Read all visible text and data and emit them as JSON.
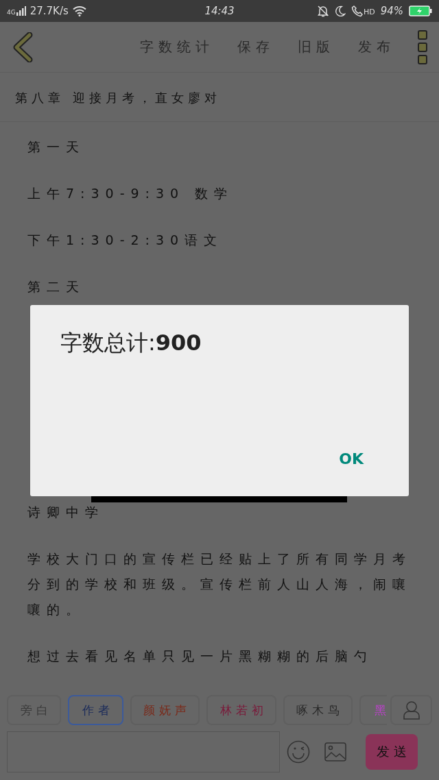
{
  "status_bar": {
    "network": "4G",
    "speed": "27.7K/s",
    "time": "14:43",
    "hd": "HD",
    "battery": "94%"
  },
  "app_bar": {
    "actions": [
      "字数统计",
      "保存",
      "旧版",
      "发布"
    ]
  },
  "document": {
    "title": "第八章 迎接月考，直女廖对",
    "paragraphs_above_dialog": [
      "第一天",
      "上午7:30-9:30 数学",
      "下午1:30-2:30语文",
      "第二天"
    ],
    "paragraphs_below_dialog": [
      "诗卿中学",
      "学校大门口的宣传栏已经贴上了所有同学月考分到的学校和班级。宣传栏前人山人海，闹嚷嚷的。",
      "想过去看见名单只见一片黑糊糊的后脑勺"
    ]
  },
  "dialog": {
    "message": "字数总计:**900**",
    "button": "OK"
  },
  "roles": [
    {
      "label": "旁白",
      "selected": false,
      "color": "#3a3a3a"
    },
    {
      "label": "作者",
      "selected": true,
      "color": "#1a2a5a"
    },
    {
      "label": "颜妩声",
      "selected": false,
      "color": "#7a2a1a"
    },
    {
      "label": "林若初",
      "selected": false,
      "color": "#7a1a3a"
    },
    {
      "label": "啄木鸟",
      "selected": false,
      "color": "#2a2a2a"
    },
    {
      "label": "黑",
      "selected": false,
      "color": "#c040d0"
    }
  ],
  "compose": {
    "send": "发送"
  }
}
